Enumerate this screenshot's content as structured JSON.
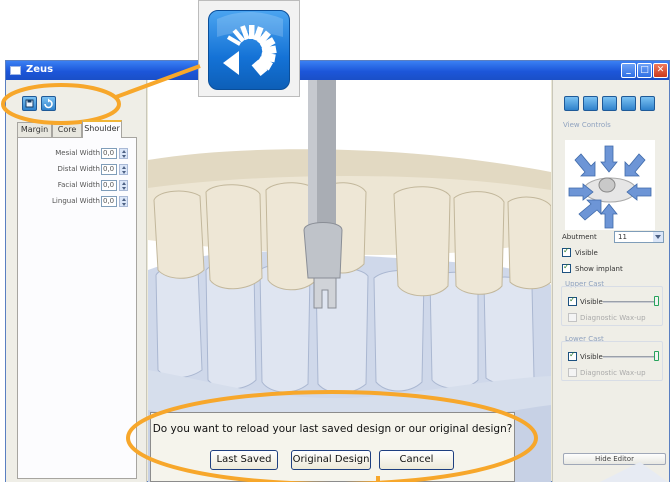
{
  "window": {
    "title": "Zeus",
    "controls": [
      "minimize",
      "maximize",
      "close"
    ]
  },
  "left_panel": {
    "toolbar_icons": [
      "save-icon",
      "reload-icon"
    ],
    "tabs": [
      {
        "label": "Margin",
        "active": false
      },
      {
        "label": "Core",
        "active": false
      },
      {
        "label": "Shoulder",
        "active": true
      }
    ],
    "fields": [
      {
        "label": "Mesial Width",
        "value": "0,0"
      },
      {
        "label": "Distal Width",
        "value": "0,0"
      },
      {
        "label": "Facial Width",
        "value": "0,0"
      },
      {
        "label": "Lingual Width",
        "value": "0,0"
      }
    ]
  },
  "right_panel": {
    "toolbar_icons": [
      "refresh-icon",
      "document-icon",
      "grid-icon",
      "tool-icon",
      "image-icon"
    ],
    "view_controls_label": "View Controls",
    "abutment_label": "Abutment",
    "abutment_value": "11",
    "visible_label": "Visible",
    "show_implant_label": "Show implant",
    "upper_cast": {
      "title": "Upper Cast",
      "visible_label": "Visible",
      "visible_checked": true,
      "diagnostic_label": "Diagnostic Wax-up",
      "opacity": 1.0
    },
    "lower_cast": {
      "title": "Lower Cast",
      "visible_label": "Visible",
      "visible_checked": true,
      "diagnostic_label": "Diagnostic Wax-up",
      "opacity": 1.0
    },
    "hide_editor_label": "Hide Editor"
  },
  "dialog": {
    "message": "Do you want to reload your last saved design or our original design?",
    "buttons": {
      "last_saved": "Last Saved",
      "original_design": "Original Design",
      "cancel": "Cancel"
    }
  },
  "colors": {
    "accent": "#f7a72b",
    "titlebar": "#1c56d9",
    "icon_blue": "#1472d6"
  }
}
